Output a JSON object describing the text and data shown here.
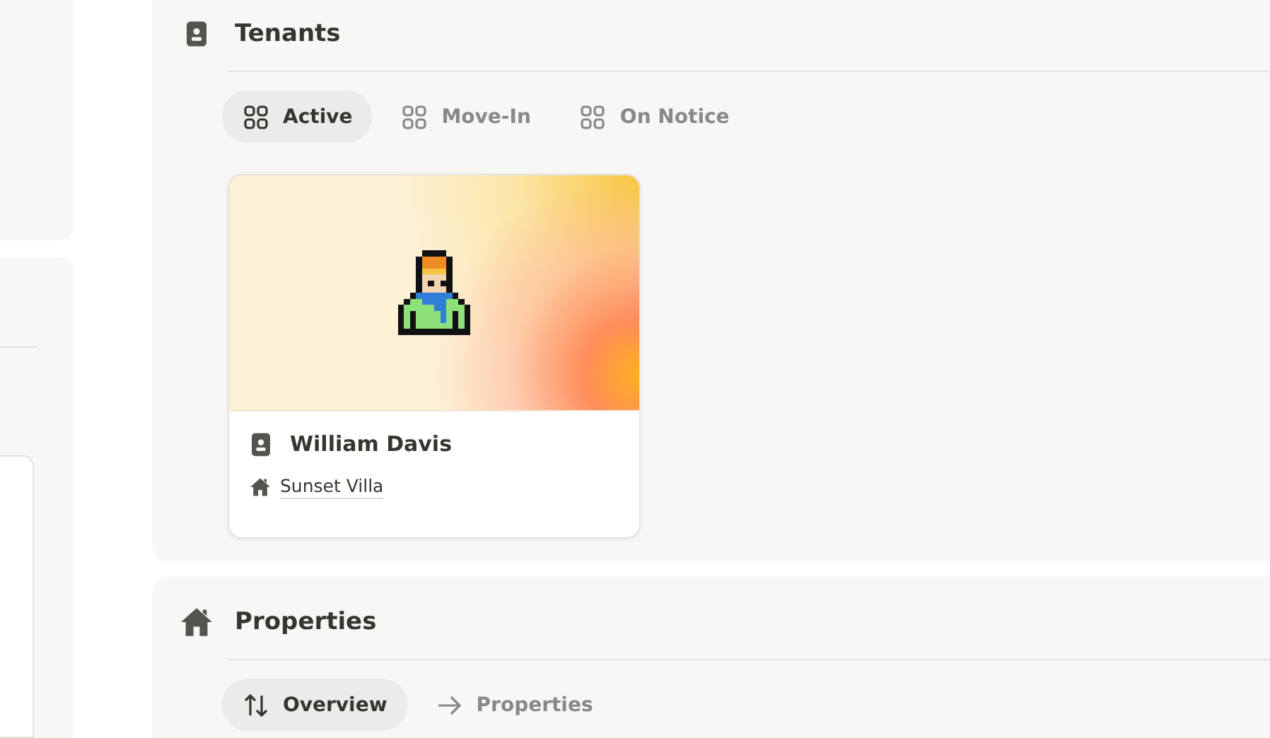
{
  "sections": [
    {
      "title": "Tenants",
      "tabs": [
        {
          "label": "Active",
          "selected": true
        },
        {
          "label": "Move-In",
          "selected": false
        },
        {
          "label": "On Notice",
          "selected": false
        }
      ],
      "cards": [
        {
          "title": "William Davis",
          "property": "Sunset Villa"
        }
      ]
    },
    {
      "title": "Properties",
      "tabs": [
        {
          "label": "Overview",
          "selected": true
        },
        {
          "label": "Properties",
          "selected": false
        }
      ]
    }
  ]
}
